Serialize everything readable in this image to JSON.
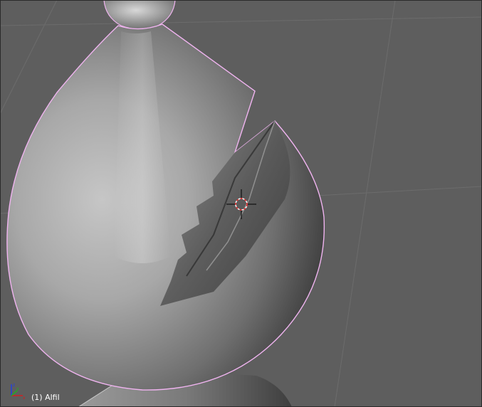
{
  "viewport": {
    "object_label": "(1) Alfil",
    "colors": {
      "background": "#5e5e5e",
      "grid_line": "#6b6b6b",
      "selection_outline": "#f0b4f0",
      "axis_x": "#d02020",
      "axis_y": "#20b020",
      "axis_z": "#2040e0"
    },
    "icons": {
      "axis_gizmo": "xyz-axis-icon",
      "cursor": "3d-cursor-icon"
    }
  }
}
